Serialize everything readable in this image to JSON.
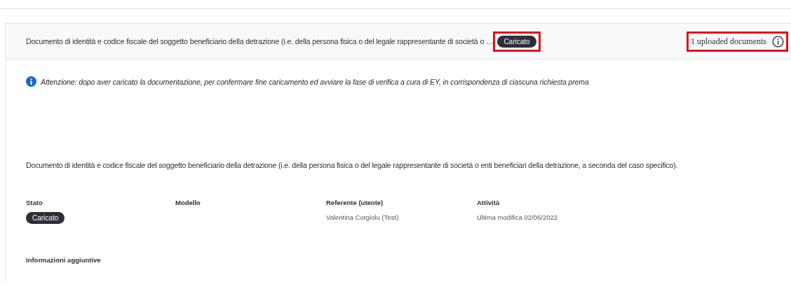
{
  "header": {
    "title": "Documento di identità e codice fiscale del soggetto beneficiario della detrazione (i.e. della persona fisica o del legale rappresentante di società o …",
    "status": {
      "label": "Caricato",
      "highlighted": true
    },
    "count": {
      "label": "1 uploaded documents",
      "highlighted": true
    }
  },
  "notice": "Attenzione: dopo aver caricato la documentazione, per confermare fine caricamento ed avviare la fase di verifica a cura di EY, in corrispondenza di ciascuna richiesta prema",
  "description": "Documento di identità e codice fiscale del soggetto beneficiario della detrazione (i.e. della persona fisica o del legale rappresentante di società o enti beneficiari della detrazione, a seconda del caso specifico).",
  "fields": [
    {
      "label": "Stato",
      "kind": "badge",
      "value": "Caricato"
    },
    {
      "label": "Modello"
    },
    {
      "label": "Referente (utente)",
      "kind": "text",
      "value": "Valentina Corgiolu (Test)"
    },
    {
      "label": "Attività",
      "kind": "text",
      "value": "Ultima modifica 02/06/2022"
    }
  ],
  "extra": {
    "label": "Informazioni aggiuntive"
  }
}
